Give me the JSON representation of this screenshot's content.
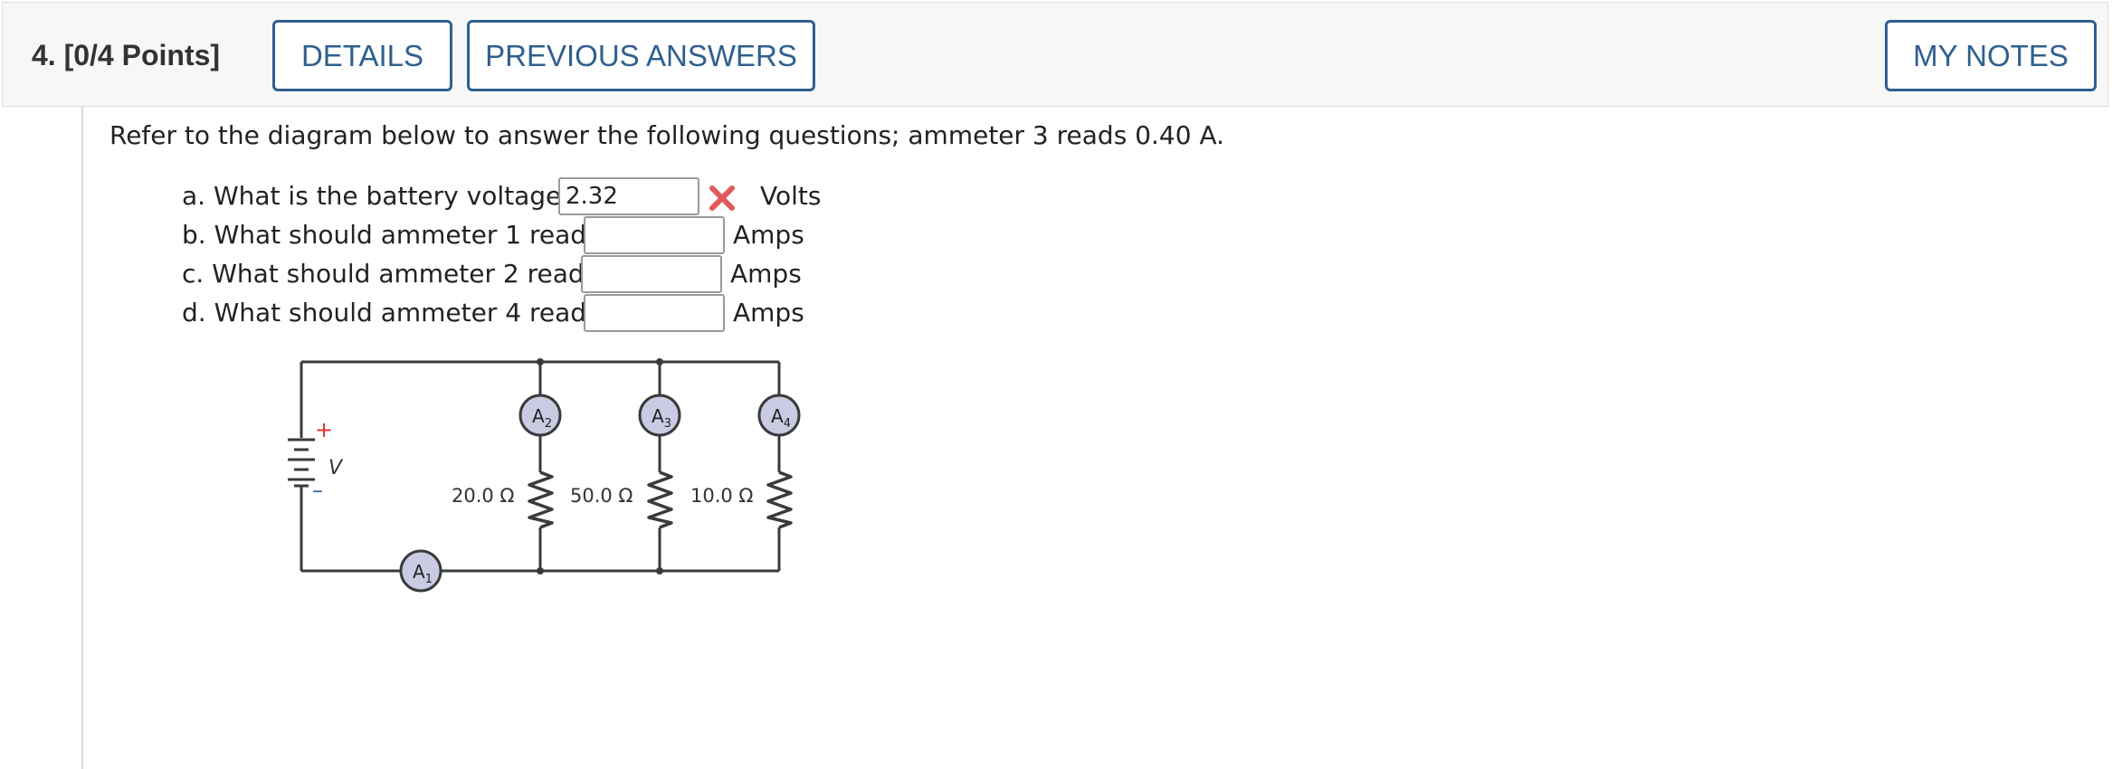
{
  "header": {
    "question_number": "4.",
    "points": "[0/4 Points]",
    "details_label": "DETAILS",
    "previous_answers_label": "PREVIOUS ANSWERS",
    "my_notes_label": "MY NOTES"
  },
  "intro": "Refer to the diagram below to answer the following questions; ammeter 3 reads 0.40 A.",
  "questions": [
    {
      "prompt": "a. What is the battery voltage?",
      "value": "2.32",
      "unit": "Volts",
      "status": "incorrect"
    },
    {
      "prompt": "b. What should ammeter 1 read?",
      "value": "",
      "unit": "Amps"
    },
    {
      "prompt": "c. What should ammeter 2 read?",
      "value": "",
      "unit": "Amps"
    },
    {
      "prompt": "d. What should ammeter 4 read?",
      "value": "",
      "unit": "Amps"
    }
  ],
  "diagram": {
    "battery_plus": "+",
    "battery_minus": "–",
    "battery_label": "V",
    "ammeters": [
      "A",
      "A",
      "A",
      "A"
    ],
    "ammeter_subscripts": [
      "1",
      "2",
      "3",
      "4"
    ],
    "resistors": [
      "20.0 Ω",
      "50.0 Ω",
      "10.0 Ω"
    ]
  },
  "colors": {
    "accent": "#2f5f8f",
    "error": "#e05a5a",
    "ammeter_fill": "#c9cbe3"
  }
}
